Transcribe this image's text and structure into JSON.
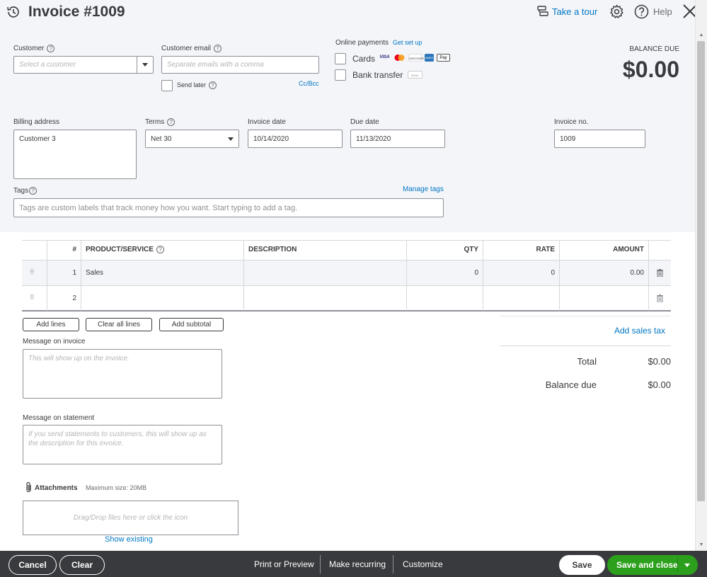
{
  "header": {
    "title": "Invoice #1009",
    "take_tour": "Take a tour",
    "help": "Help"
  },
  "customer": {
    "label": "Customer",
    "placeholder": "Select a customer"
  },
  "email": {
    "label": "Customer email",
    "placeholder": "Separate emails with a comma",
    "send_later": "Send later",
    "cc_bcc": "Cc/Bcc"
  },
  "online_payments": {
    "label": "Online payments",
    "get_set_up": "Get set up",
    "cards": "Cards",
    "bank_transfer": "Bank transfer",
    "logos": [
      "VISA",
      "MC",
      "DISCOVER",
      "AMEX",
      "Pay"
    ],
    "bank_logo": "BANK"
  },
  "balance": {
    "label": "BALANCE DUE",
    "amount": "$0.00"
  },
  "billing": {
    "label": "Billing address",
    "value": "Customer 3"
  },
  "terms": {
    "label": "Terms",
    "value": "Net 30"
  },
  "invoice_date": {
    "label": "Invoice date",
    "value": "10/14/2020"
  },
  "due_date": {
    "label": "Due date",
    "value": "11/13/2020"
  },
  "invoice_no": {
    "label": "Invoice no.",
    "value": "1009"
  },
  "tags": {
    "label": "Tags",
    "manage": "Manage tags",
    "placeholder": "Tags are custom labels that track money how you want. Start typing to add a tag."
  },
  "table": {
    "headers": {
      "num": "#",
      "product": "PRODUCT/SERVICE",
      "description": "DESCRIPTION",
      "qty": "QTY",
      "rate": "RATE",
      "amount": "AMOUNT"
    },
    "rows": [
      {
        "num": "1",
        "product": "Sales",
        "description": "",
        "qty": "0",
        "rate": "0",
        "amount": "0.00"
      },
      {
        "num": "2",
        "product": "",
        "description": "",
        "qty": "",
        "rate": "",
        "amount": ""
      }
    ]
  },
  "line_buttons": {
    "add_lines": "Add lines",
    "clear_all": "Clear all lines",
    "add_subtotal": "Add subtotal"
  },
  "message_invoice": {
    "label": "Message on invoice",
    "placeholder": "This will show up on the invoice."
  },
  "message_statement": {
    "label": "Message on statement",
    "placeholder": "If you send statements to customers, this will show up as the description for this invoice."
  },
  "attachments": {
    "label": "Attachments",
    "max_size": "Maximum size: 20MB",
    "drop_text": "Drag/Drop files here or click the icon",
    "show_existing": "Show existing"
  },
  "totals": {
    "add_sales_tax": "Add sales tax",
    "total_label": "Total",
    "total_value": "$0.00",
    "balance_label": "Balance due",
    "balance_value": "$0.00"
  },
  "footer": {
    "cancel": "Cancel",
    "clear": "Clear",
    "print_preview": "Print or Preview",
    "make_recurring": "Make recurring",
    "customize": "Customize",
    "save": "Save",
    "save_close": "Save and close"
  },
  "colors": {
    "accent_link": "#0077c5",
    "primary_green": "#2ca01c",
    "footer_bg": "#393a3d",
    "top_bg": "#f4f5f8"
  }
}
